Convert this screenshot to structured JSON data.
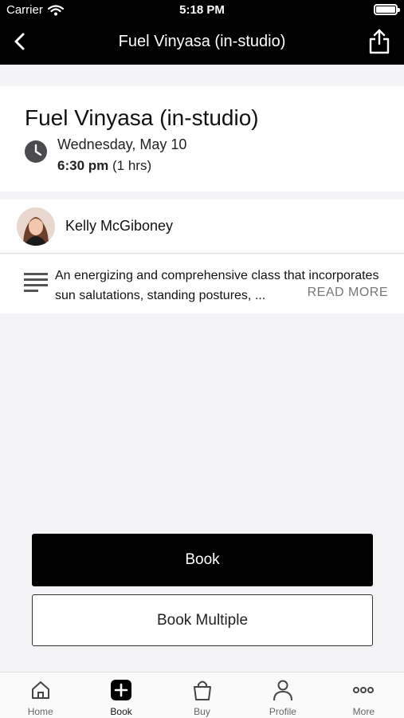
{
  "status_bar": {
    "carrier": "Carrier",
    "time": "5:18 PM",
    "battery_level": 1.0
  },
  "nav": {
    "title": "Fuel Vinyasa (in-studio)"
  },
  "class_info": {
    "title": "Fuel Vinyasa (in-studio)",
    "date": "Wednesday, May 10",
    "time": "6:30 pm",
    "duration": "(1 hrs)"
  },
  "instructor": {
    "name": "Kelly McGiboney"
  },
  "description": {
    "text": "An energizing and comprehensive class that incorporates sun salutations, standing postures, ...",
    "read_more": "READ MORE"
  },
  "actions": {
    "book": "Book",
    "book_multiple": "Book Multiple"
  },
  "tabs": [
    {
      "label": "Home",
      "icon": "home-icon"
    },
    {
      "label": "Book",
      "icon": "plus-square-icon",
      "active": true
    },
    {
      "label": "Buy",
      "icon": "bag-icon"
    },
    {
      "label": "Profile",
      "icon": "person-icon"
    },
    {
      "label": "More",
      "icon": "ellipsis-icon"
    }
  ],
  "colors": {
    "primary": "#000000",
    "background": "#f4f4f6",
    "muted_text": "#777777"
  }
}
